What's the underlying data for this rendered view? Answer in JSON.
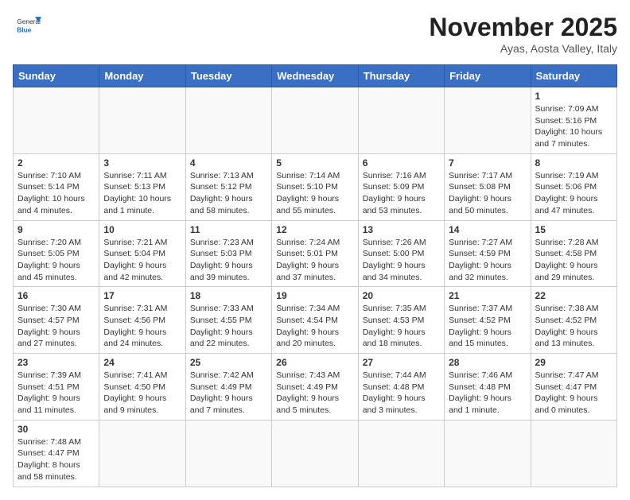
{
  "header": {
    "logo": {
      "general": "General",
      "blue": "Blue"
    },
    "title": "November 2025",
    "location": "Ayas, Aosta Valley, Italy"
  },
  "weekdays": [
    "Sunday",
    "Monday",
    "Tuesday",
    "Wednesday",
    "Thursday",
    "Friday",
    "Saturday"
  ],
  "weeks": [
    [
      null,
      null,
      null,
      null,
      null,
      null,
      {
        "day": 1,
        "sunrise": "7:09 AM",
        "sunset": "5:16 PM",
        "daylight": "10 hours and 7 minutes."
      }
    ],
    [
      {
        "day": 2,
        "sunrise": "7:10 AM",
        "sunset": "5:14 PM",
        "daylight": "10 hours and 4 minutes."
      },
      {
        "day": 3,
        "sunrise": "7:11 AM",
        "sunset": "5:13 PM",
        "daylight": "10 hours and 1 minute."
      },
      {
        "day": 4,
        "sunrise": "7:13 AM",
        "sunset": "5:12 PM",
        "daylight": "9 hours and 58 minutes."
      },
      {
        "day": 5,
        "sunrise": "7:14 AM",
        "sunset": "5:10 PM",
        "daylight": "9 hours and 55 minutes."
      },
      {
        "day": 6,
        "sunrise": "7:16 AM",
        "sunset": "5:09 PM",
        "daylight": "9 hours and 53 minutes."
      },
      {
        "day": 7,
        "sunrise": "7:17 AM",
        "sunset": "5:08 PM",
        "daylight": "9 hours and 50 minutes."
      },
      {
        "day": 8,
        "sunrise": "7:19 AM",
        "sunset": "5:06 PM",
        "daylight": "9 hours and 47 minutes."
      }
    ],
    [
      {
        "day": 9,
        "sunrise": "7:20 AM",
        "sunset": "5:05 PM",
        "daylight": "9 hours and 45 minutes."
      },
      {
        "day": 10,
        "sunrise": "7:21 AM",
        "sunset": "5:04 PM",
        "daylight": "9 hours and 42 minutes."
      },
      {
        "day": 11,
        "sunrise": "7:23 AM",
        "sunset": "5:03 PM",
        "daylight": "9 hours and 39 minutes."
      },
      {
        "day": 12,
        "sunrise": "7:24 AM",
        "sunset": "5:01 PM",
        "daylight": "9 hours and 37 minutes."
      },
      {
        "day": 13,
        "sunrise": "7:26 AM",
        "sunset": "5:00 PM",
        "daylight": "9 hours and 34 minutes."
      },
      {
        "day": 14,
        "sunrise": "7:27 AM",
        "sunset": "4:59 PM",
        "daylight": "9 hours and 32 minutes."
      },
      {
        "day": 15,
        "sunrise": "7:28 AM",
        "sunset": "4:58 PM",
        "daylight": "9 hours and 29 minutes."
      }
    ],
    [
      {
        "day": 16,
        "sunrise": "7:30 AM",
        "sunset": "4:57 PM",
        "daylight": "9 hours and 27 minutes."
      },
      {
        "day": 17,
        "sunrise": "7:31 AM",
        "sunset": "4:56 PM",
        "daylight": "9 hours and 24 minutes."
      },
      {
        "day": 18,
        "sunrise": "7:33 AM",
        "sunset": "4:55 PM",
        "daylight": "9 hours and 22 minutes."
      },
      {
        "day": 19,
        "sunrise": "7:34 AM",
        "sunset": "4:54 PM",
        "daylight": "9 hours and 20 minutes."
      },
      {
        "day": 20,
        "sunrise": "7:35 AM",
        "sunset": "4:53 PM",
        "daylight": "9 hours and 18 minutes."
      },
      {
        "day": 21,
        "sunrise": "7:37 AM",
        "sunset": "4:52 PM",
        "daylight": "9 hours and 15 minutes."
      },
      {
        "day": 22,
        "sunrise": "7:38 AM",
        "sunset": "4:52 PM",
        "daylight": "9 hours and 13 minutes."
      }
    ],
    [
      {
        "day": 23,
        "sunrise": "7:39 AM",
        "sunset": "4:51 PM",
        "daylight": "9 hours and 11 minutes."
      },
      {
        "day": 24,
        "sunrise": "7:41 AM",
        "sunset": "4:50 PM",
        "daylight": "9 hours and 9 minutes."
      },
      {
        "day": 25,
        "sunrise": "7:42 AM",
        "sunset": "4:49 PM",
        "daylight": "9 hours and 7 minutes."
      },
      {
        "day": 26,
        "sunrise": "7:43 AM",
        "sunset": "4:49 PM",
        "daylight": "9 hours and 5 minutes."
      },
      {
        "day": 27,
        "sunrise": "7:44 AM",
        "sunset": "4:48 PM",
        "daylight": "9 hours and 3 minutes."
      },
      {
        "day": 28,
        "sunrise": "7:46 AM",
        "sunset": "4:48 PM",
        "daylight": "9 hours and 1 minute."
      },
      {
        "day": 29,
        "sunrise": "7:47 AM",
        "sunset": "4:47 PM",
        "daylight": "9 hours and 0 minutes."
      }
    ],
    [
      {
        "day": 30,
        "sunrise": "7:48 AM",
        "sunset": "4:47 PM",
        "daylight": "8 hours and 58 minutes."
      },
      null,
      null,
      null,
      null,
      null,
      null
    ]
  ]
}
